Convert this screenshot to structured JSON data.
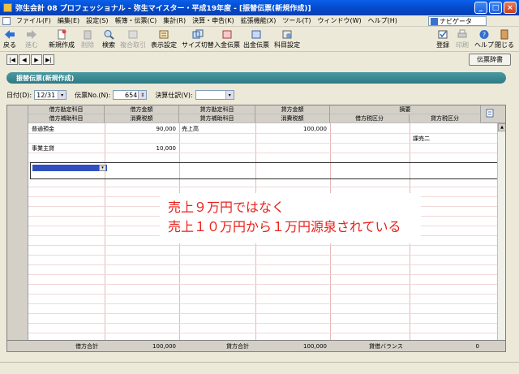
{
  "window": {
    "title": "弥生会計 08 プロフェッショナル - 弥生マイスター・平成19年度 - [振替伝票(新規作成)]",
    "controls": [
      "_",
      "□",
      "×"
    ]
  },
  "menu": {
    "items": [
      "ファイル(F)",
      "編集(E)",
      "設定(S)",
      "帳簿・伝票(C)",
      "集計(R)",
      "決算・申告(K)",
      "拡張機能(X)",
      "ツール(T)",
      "ウィンドウ(W)",
      "ヘルプ(H)"
    ],
    "navi": "ナビゲータ"
  },
  "toolbar": {
    "back": "戻る",
    "forward": "進む",
    "new": "新規作成",
    "delete": "削除",
    "search": "検索",
    "compound": "複合取引",
    "display": "表示設定",
    "resize": "サイズ切替",
    "cash_in": "入金伝票",
    "cash_out": "出金伝票",
    "account": "科目設定",
    "register": "登録",
    "print": "印刷",
    "help": "ヘルプ",
    "close": "閉じる"
  },
  "nav_buttons": [
    "|◀",
    "◀",
    "▶",
    "▶|"
  ],
  "dict_button": "伝票辞書",
  "header": "振替伝票(新規作成)",
  "form": {
    "date_label": "日付(D):",
    "date_value": "12/31",
    "voucher_no_label": "伝票No.(N):",
    "voucher_no_value": "654",
    "settlement_label": "決算仕訳(V):",
    "settlement_value": ""
  },
  "grid": {
    "headers_top": [
      "借方勘定科目",
      "借方金額",
      "貸方勘定科目",
      "貸方金額",
      "摘要"
    ],
    "headers_bottom": [
      "借方補助科目",
      "消費税額",
      "貸方補助科目",
      "消費税額",
      "借方税区分",
      "貸方税区分"
    ],
    "rows": [
      {
        "debit_account": "普通預金",
        "debit_amount": "90,000",
        "credit_account": "売上高",
        "credit_amount": "100,000",
        "credit_tax": "",
        "credit_tax_class": "課売二"
      },
      {
        "debit_account": "事業主貸",
        "debit_amount": "10,000",
        "credit_account": "",
        "credit_amount": "",
        "credit_tax": "",
        "credit_tax_class": ""
      }
    ],
    "footer": {
      "debit_total_label": "借方合計",
      "debit_total": "100,000",
      "credit_total_label": "貸方合計",
      "credit_total": "100,000",
      "balance_label": "貸借バランス",
      "balance": "0"
    }
  },
  "annotation": {
    "line1": "売上９万円ではなく",
    "line2": "売上１０万円から１万円源泉されている"
  },
  "colors": {
    "header_bar": "#2e7a84",
    "annotation_text": "#e8201a"
  }
}
